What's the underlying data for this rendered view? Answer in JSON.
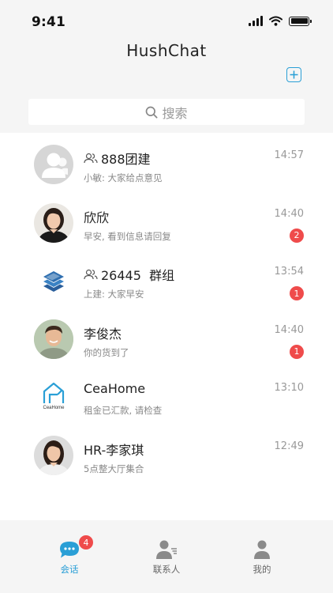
{
  "status_bar": {
    "time": "9:41"
  },
  "header": {
    "title": "HushChat"
  },
  "search": {
    "placeholder": "搜索"
  },
  "chats": [
    {
      "name": "888团建",
      "is_group": true,
      "preview": "小敏: 大家给点意见",
      "time": "14:57",
      "unread": "",
      "avatar": "default-avatar"
    },
    {
      "name": "欣欣",
      "is_group": false,
      "preview": "早安, 看到信息请回复",
      "time": "14:40",
      "unread": "2",
      "avatar": "woman-photo"
    },
    {
      "name": "26445  群组",
      "is_group": true,
      "preview": "上建: 大家早安",
      "time": "13:54",
      "unread": "1",
      "avatar": "layers-logo"
    },
    {
      "name": "李俊杰",
      "is_group": false,
      "preview": "你的货到了",
      "time": "14:40",
      "unread": "1",
      "avatar": "man-photo"
    },
    {
      "name": "CeaHome",
      "is_group": false,
      "preview": "租金已汇款, 请检查",
      "time": "13:10",
      "unread": "",
      "avatar": "ceahome-logo",
      "logo_text": "CeaHome"
    },
    {
      "name": "HR-李家琪",
      "is_group": false,
      "preview": "5点整大厅集合",
      "time": "12:49",
      "unread": "",
      "avatar": "woman-photo"
    }
  ],
  "tabs": [
    {
      "label": "会话",
      "badge": "4",
      "active": true
    },
    {
      "label": "联系人",
      "badge": "",
      "active": false
    },
    {
      "label": "我的",
      "badge": "",
      "active": false
    }
  ],
  "colors": {
    "accent": "#2a9fd6",
    "badge": "#ef4b4b",
    "background": "#f5f5f5"
  }
}
